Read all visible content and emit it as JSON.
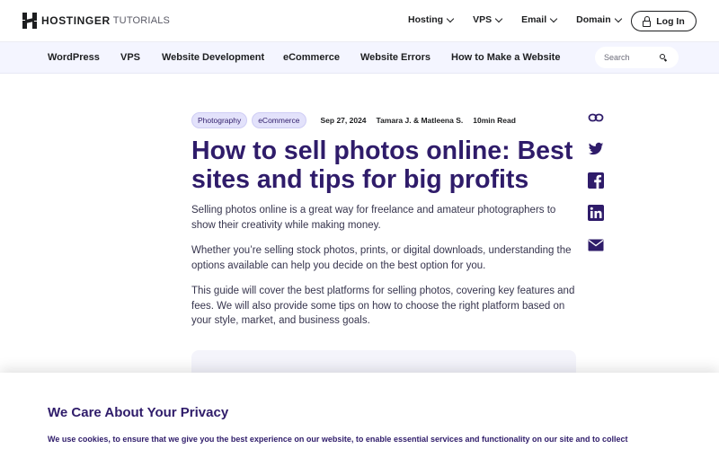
{
  "header": {
    "logo_text": "HOSTINGER",
    "logo_sub": "TUTORIALS",
    "nav": [
      {
        "label": "Hosting"
      },
      {
        "label": "VPS"
      },
      {
        "label": "Email"
      },
      {
        "label": "Domain"
      }
    ],
    "login_label": "Log In"
  },
  "categories": [
    {
      "label": "WordPress"
    },
    {
      "label": "VPS"
    },
    {
      "label": "Website Development"
    },
    {
      "label": "eCommerce"
    },
    {
      "label": "Website Errors"
    },
    {
      "label": "How to Make a Website"
    }
  ],
  "search": {
    "placeholder": "Search"
  },
  "article": {
    "tags": [
      "Photography",
      "eCommerce"
    ],
    "date": "Sep 27, 2024",
    "authors": "Tamara J. & Matleena S.",
    "read_time": "10min Read",
    "title": "How to sell photos online: Best sites and tips for big profits",
    "paragraphs": [
      "Selling photos online is a great way for freelance and amateur photographers to show their creativity while making money.",
      "Whether you’re selling stock photos, prints, or digital downloads, understanding the options available can help you decide on the best option for you.",
      "This guide will cover the best platforms for selling photos, covering key features and fees. We will also provide some tips on how to choose the right platform based on your style, market, and business goals."
    ]
  },
  "share": [
    "link-icon",
    "twitter-icon",
    "facebook-icon",
    "linkedin-icon",
    "email-icon"
  ],
  "cookie": {
    "title": "We Care About Your Privacy",
    "text": "We use cookies, to ensure that we give you the best experience on our website, to enable essential services and functionality on our site and to collect"
  },
  "colors": {
    "brand_purple": "#2f1c6a",
    "nav_bg": "#f4f5ff",
    "tag_bg": "#e3e2fb",
    "text_dark": "#1d1e20"
  }
}
